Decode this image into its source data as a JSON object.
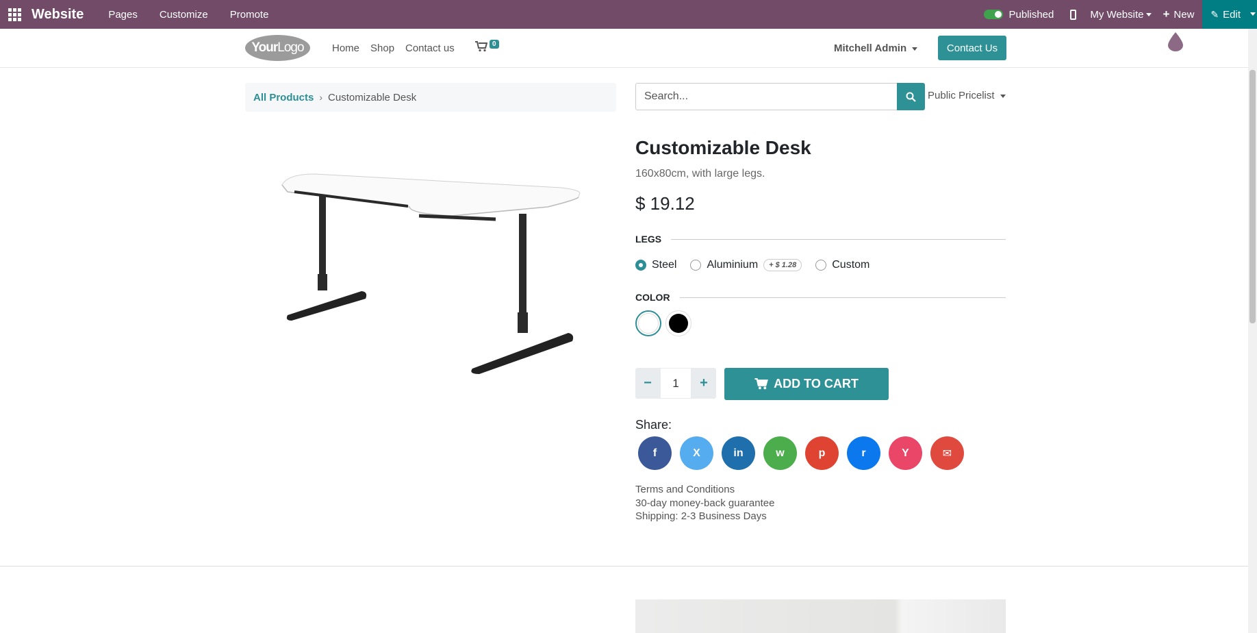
{
  "admin_bar": {
    "brand": "Website",
    "menus": [
      "Pages",
      "Customize",
      "Promote"
    ],
    "published_label": "Published",
    "my_website_label": "My Website",
    "new_label": "New",
    "edit_label": "Edit"
  },
  "header": {
    "logo_text_bold": "Your",
    "logo_text": "Logo",
    "nav": [
      "Home",
      "Shop",
      "Contact us"
    ],
    "cart_count": "0",
    "user": "Mitchell Admin",
    "contact_button": "Contact Us"
  },
  "breadcrumb": {
    "parent": "All Products",
    "current": "Customizable Desk"
  },
  "search": {
    "placeholder": "Search...",
    "pricelist": "Public Pricelist"
  },
  "product": {
    "name": "Customizable Desk",
    "description": "160x80cm, with large legs.",
    "price": "$ 19.12",
    "attributes": {
      "legs_label": "LEGS",
      "legs_options": [
        {
          "label": "Steel",
          "selected": true
        },
        {
          "label": "Aluminium",
          "extra": "+ $ 1.28"
        },
        {
          "label": "Custom"
        }
      ],
      "color_label": "COLOR",
      "colors": [
        "#ffffff",
        "#000000"
      ]
    },
    "quantity": "1",
    "add_to_cart": "ADD TO CART"
  },
  "share": {
    "label": "Share:",
    "networks": [
      {
        "name": "facebook",
        "glyph": "f",
        "color": "#3b5998"
      },
      {
        "name": "x",
        "glyph": "X",
        "color": "#55acee"
      },
      {
        "name": "linkedin",
        "glyph": "in",
        "color": "#1f6fad"
      },
      {
        "name": "whatsapp",
        "glyph": "w",
        "color": "#4bad4b"
      },
      {
        "name": "pinterest",
        "glyph": "p",
        "color": "#df4432"
      },
      {
        "name": "reddit",
        "glyph": "r",
        "color": "#0c78ee"
      },
      {
        "name": "hackernews",
        "glyph": "Y",
        "color": "#e94668"
      },
      {
        "name": "email",
        "glyph": "✉",
        "color": "#e04a3e"
      }
    ]
  },
  "info": {
    "terms": "Terms and Conditions",
    "guarantee": "30-day money-back guarantee",
    "shipping": "Shipping: 2-3 Business Days"
  }
}
